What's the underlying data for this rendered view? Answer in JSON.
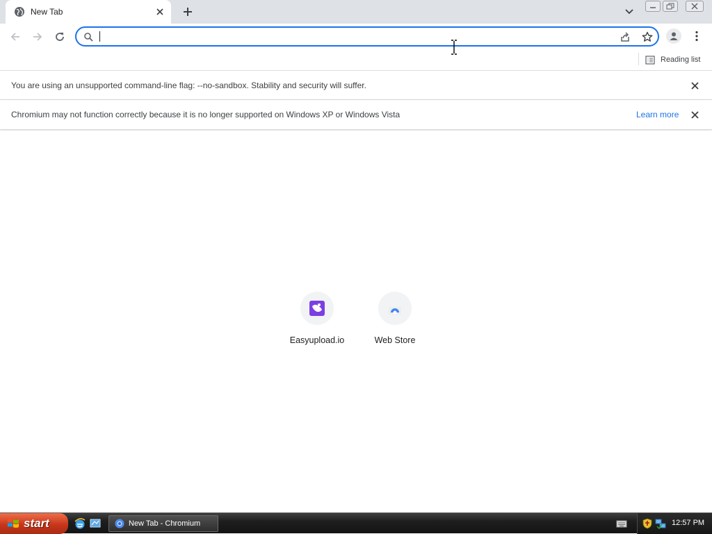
{
  "browser": {
    "tab": {
      "title": "New Tab"
    },
    "omnibox": {
      "value": "",
      "placeholder": ""
    },
    "bookmarks_bar": {
      "reading_list_label": "Reading list"
    },
    "infobars": [
      {
        "text": "You are using an unsupported command-line flag: --no-sandbox. Stability and security will suffer.",
        "link": ""
      },
      {
        "text": "Chromium may not function correctly because it is no longer supported on Windows XP or Windows Vista",
        "link": "Learn more"
      }
    ],
    "shortcuts": [
      {
        "label": "Easyupload.io",
        "icon": "easyupload-icon",
        "color": "#7b3fe4"
      },
      {
        "label": "Web Store",
        "icon": "web-store-icon",
        "color": "#4285f4"
      }
    ],
    "accent_color": "#1a73e8"
  },
  "taskbar": {
    "start_label": "start",
    "window_title": "New Tab - Chromium",
    "clock": "12:57 PM"
  }
}
